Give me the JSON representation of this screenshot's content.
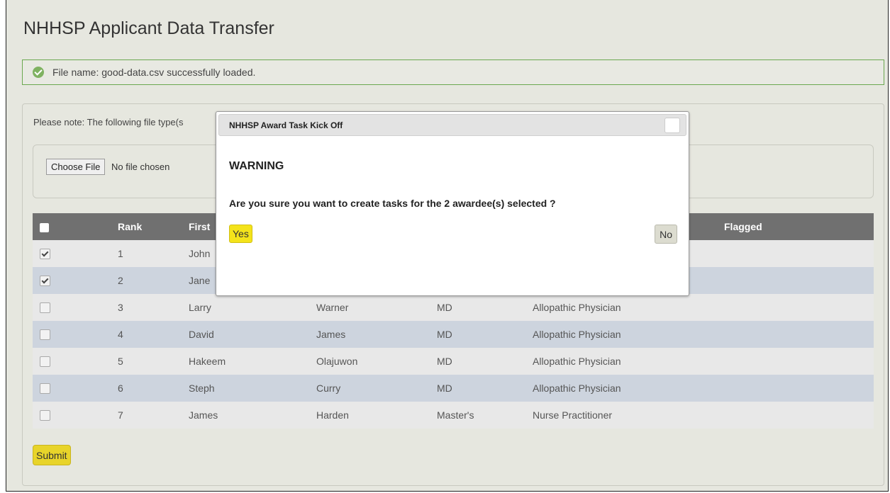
{
  "page": {
    "title": "NHHSP Applicant Data Transfer"
  },
  "alert": {
    "message": "File name: good-data.csv successfully loaded."
  },
  "upload": {
    "note": "Please note: The following file type(s",
    "choose_label": "Choose File",
    "no_file_text": "No file chosen"
  },
  "table": {
    "headers": {
      "rank": "Rank",
      "first": "First",
      "flagged": "Flagged"
    },
    "rows": [
      {
        "checked": true,
        "rank": "1",
        "first": "John",
        "last": "",
        "degree": "",
        "discipline": ""
      },
      {
        "checked": true,
        "rank": "2",
        "first": "Jane",
        "last": "",
        "degree": "",
        "discipline": ""
      },
      {
        "checked": false,
        "rank": "3",
        "first": "Larry",
        "last": "Warner",
        "degree": "MD",
        "discipline": "Allopathic Physician"
      },
      {
        "checked": false,
        "rank": "4",
        "first": "David",
        "last": "James",
        "degree": "MD",
        "discipline": "Allopathic Physician"
      },
      {
        "checked": false,
        "rank": "5",
        "first": "Hakeem",
        "last": "Olajuwon",
        "degree": "MD",
        "discipline": "Allopathic Physician"
      },
      {
        "checked": false,
        "rank": "6",
        "first": "Steph",
        "last": "Curry",
        "degree": "MD",
        "discipline": "Allopathic Physician"
      },
      {
        "checked": false,
        "rank": "7",
        "first": "James",
        "last": "Harden",
        "degree": "Master's",
        "discipline": "Nurse Practitioner"
      }
    ]
  },
  "submit_label": "Submit",
  "dialog": {
    "title": "NHHSP Award Task Kick Off",
    "heading": "WARNING",
    "message": "Are you sure you want to create tasks for the 2 awardee(s) selected ?",
    "yes_label": "Yes",
    "no_label": "No"
  },
  "colors": {
    "accent_yellow": "#f4e31b",
    "success_green": "#7fb261",
    "header_gray": "#707070",
    "row_blue": "#cdd4de"
  }
}
